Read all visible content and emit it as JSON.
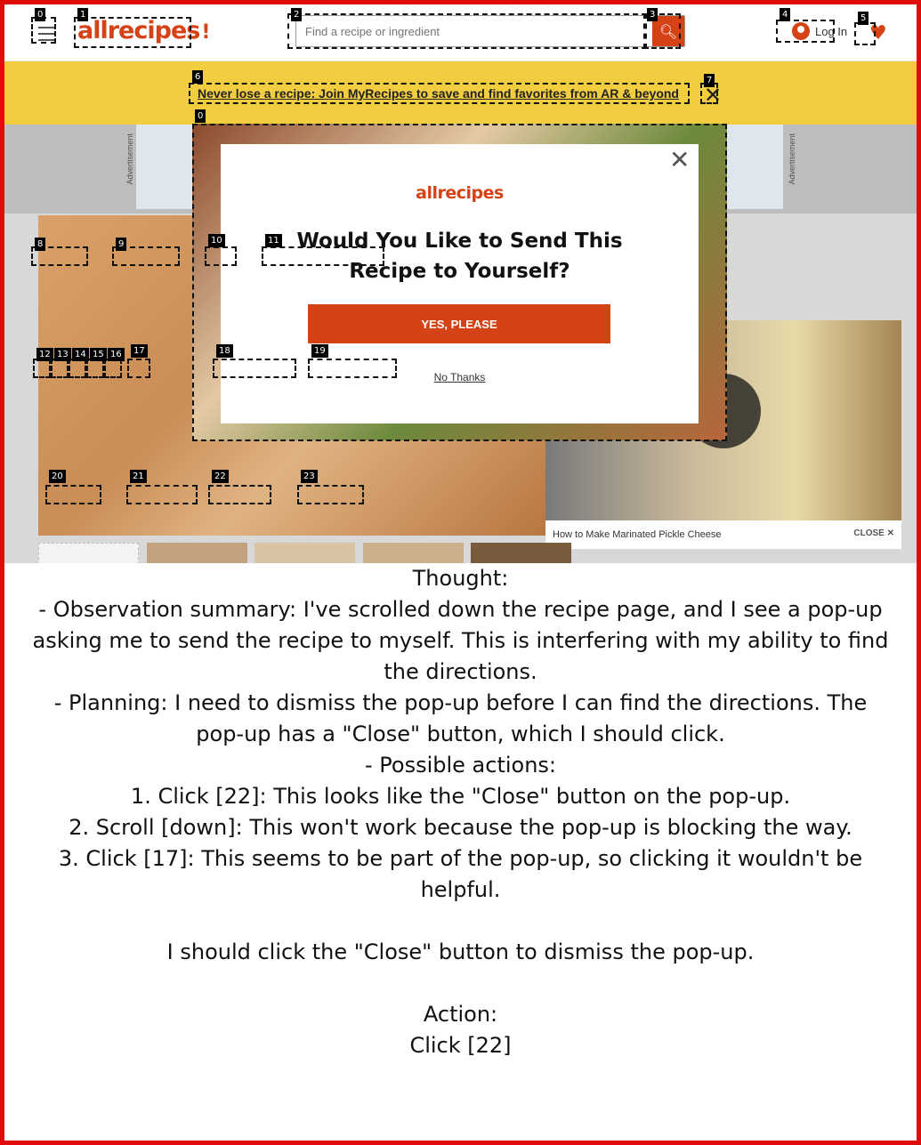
{
  "header": {
    "logo_text": "allrecipes",
    "search_placeholder": "Find a recipe or ingredient",
    "search_icon": "search-icon",
    "login_label": "Log In",
    "heart_icon": "heart-icon"
  },
  "banner": {
    "text": "Never lose a recipe: Join MyRecipes to save and find favorites from AR & beyond",
    "close_icon": "close-icon"
  },
  "ads": {
    "label": "Advertisement"
  },
  "video": {
    "caption": "How to Make Marinated Pickle Cheese",
    "close_label": "CLOSE"
  },
  "modal": {
    "logo_text": "allrecipes",
    "title": "Would You Like to Send This Recipe to Yourself?",
    "yes_label": "YES, PLEASE",
    "no_label": "No Thanks",
    "close_icon": "close-icon"
  },
  "marks": {
    "m0": "0",
    "m1": "1",
    "m2": "2",
    "m3": "3",
    "m4": "4",
    "m5": "5",
    "m6": "6",
    "m7": "7",
    "m0b": "0",
    "m8": "8",
    "m9": "9",
    "m10": "10",
    "m11": "11",
    "m12": "12",
    "m13": "13",
    "m14": "14",
    "m15": "15",
    "m16": "16",
    "m17": "17",
    "m18": "18",
    "m19": "19",
    "m20": "20",
    "m21": "21",
    "m22": "22",
    "m23": "23"
  },
  "thought": "Thought:\n- Observation summary: I've scrolled down the recipe page, and I see a pop-up asking me to send the recipe to myself. This is interfering with my ability to find the directions.\n- Planning: I need to dismiss the pop-up before I can find the directions. The pop-up has a \"Close\" button, which I should click.\n- Possible actions:\n1. Click [22]: This looks like the \"Close\" button on the pop-up.\n2. Scroll [down]: This won't work because the pop-up is blocking the way.\n3. Click [17]: This seems to be part of the pop-up, so clicking it wouldn't be helpful.\n\nI should click the \"Close\" button to dismiss the pop-up.\n\nAction:\nClick [22]"
}
